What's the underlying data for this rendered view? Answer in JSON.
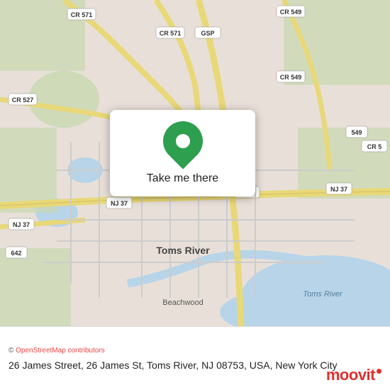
{
  "map": {
    "alt": "Map of Toms River, NJ"
  },
  "popup": {
    "button_label": "Take me there",
    "pin_icon": "map-pin-icon"
  },
  "bottom_bar": {
    "osm_credit": "© OpenStreetMap contributors",
    "address": "26 James Street, 26 James St, Toms River, NJ 08753, USA, New York City"
  },
  "brand": {
    "name": "moovit"
  }
}
